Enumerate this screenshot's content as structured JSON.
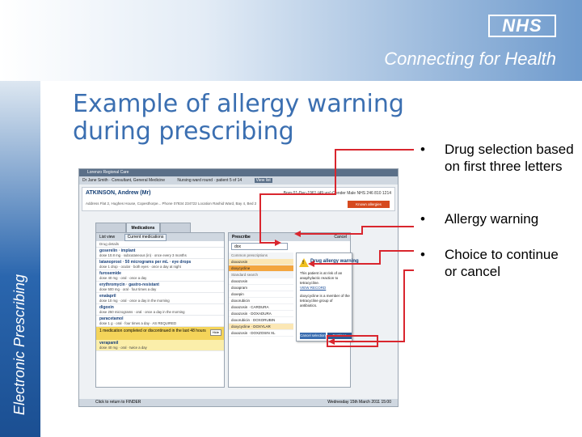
{
  "header": {
    "logo_text": "NHS",
    "tagline": "Connecting for Health"
  },
  "side_label": "Electronic Prescribing",
  "title": "Example of allergy warning during prescribing",
  "bullets": [
    {
      "marker": "•",
      "text": "Drug selection based on first three letters"
    },
    {
      "marker": "•",
      "text": "Allergy warning"
    },
    {
      "marker": "•",
      "text": "Choice to continue or cancel"
    }
  ],
  "screenshot": {
    "window_title": "Lorenzo Regional Care",
    "user_bar": [
      "Dr Jane Smith · Consultant, General Medicine",
      "Nursing ward round · patient 5 of 14",
      "View list"
    ],
    "patient": {
      "name": "ATKINSON, Andrew (Mr)",
      "info": "Born 01-Dec-1961 (49 yrs)   Gender Male   NHS 246 810 1214",
      "address": "Address Flat 2, Hughes House, Copesthorpe...   Phone 07834 234722   Location Rashid Ward, Bay 4, Bed 2",
      "allergy_badge": "Known allergies"
    },
    "tabs": [
      "",
      "Medications",
      ""
    ],
    "list_pane": {
      "header": "List view",
      "selector": "Current medications",
      "subheader": "Drug details",
      "meds": [
        {
          "name": "goserelin · implant",
          "detail": "dose 10.8 mg · subcutaneous (in) · once every 3 months"
        },
        {
          "name": "latanoprost · 50 micrograms per mL · eye drops",
          "detail": "dose 1 drop · ocular · both eyes · once a day at night"
        },
        {
          "name": "furosemide",
          "detail": "dose 40 mg · oral · once a day"
        },
        {
          "name": "erythromycin · gastro-resistant",
          "detail": "dose 500 mg · oral · four times a day"
        },
        {
          "name": "enalapril",
          "detail": "dose 10 mg · oral · once a day in the morning"
        },
        {
          "name": "digoxin",
          "detail": "dose 250 micrograms · oral · once a day in the morning"
        },
        {
          "name": "paracetamol",
          "detail": "dose 1 g · oral · four times a day · AS REQUIRED"
        }
      ],
      "disc_text": "1 medication completed or discontinued in the last 48 hours",
      "hide_label": "Hide",
      "disc_med": {
        "name": "verapamil",
        "detail": "dose 40 mg · oral · twice a day"
      }
    },
    "prescribe_pane": {
      "header": "Prescribe",
      "cancel": "Cancel",
      "search_value": "dox",
      "common_label": "Common prescriptions",
      "standard_label": "Standard search",
      "common": [
        "doxazosin",
        "doxycycline"
      ],
      "standard": [
        "doxazosin",
        "doxapram",
        "doxepin",
        "doxorubicin",
        "doxazosin · CARDURA",
        "doxazosin · DOXADURA",
        "doxorubicin · DOXORUBIN",
        "doxycycline · DOXYLAR",
        "doxazosin · DOXZOSIN XL"
      ]
    },
    "warning": {
      "title": "Drug allergy warning",
      "text": "This patient is at risk of an anaphylactic reaction to tetracycline.",
      "link": "VIEW RECORD",
      "text2": "doxycycline is a member of the tetracycline group of antibiotics.",
      "cancel_button": "Cancel selection",
      "continue_button": "Continue anyway"
    },
    "bottom_left": "Click to return to FINDER",
    "bottom_right": "Wednesday 15th March 2011  15:00"
  },
  "colors": {
    "title": "#3b6fb1",
    "callout_line": "#d9262e",
    "header_blue": "#6f9bcd"
  }
}
